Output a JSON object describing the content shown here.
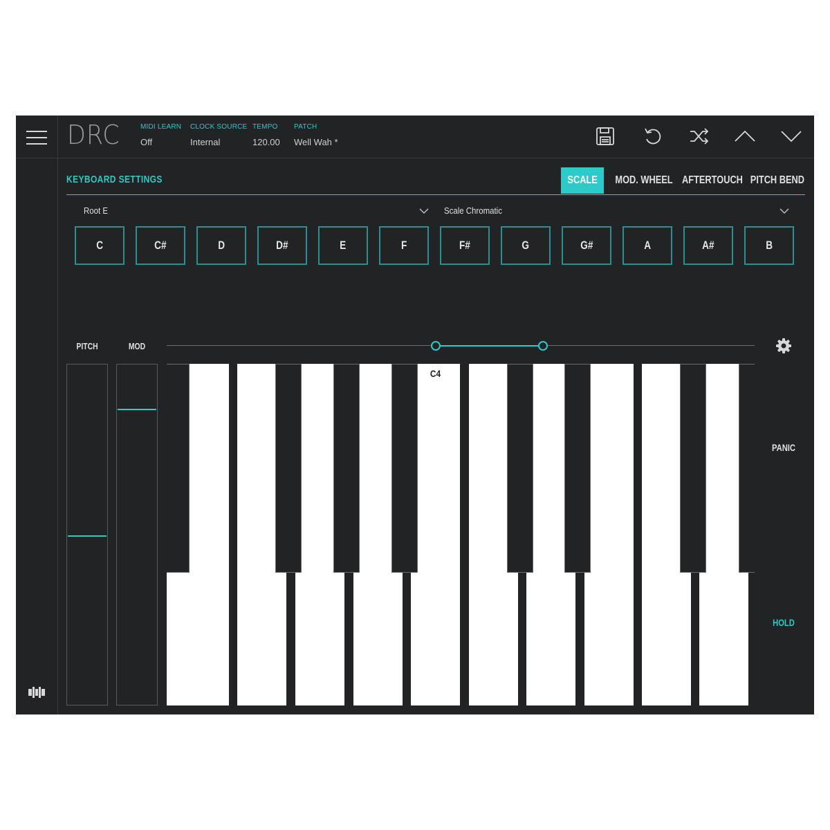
{
  "app": {
    "logo": "DRC",
    "accent_color": "#2ec9c9",
    "background_color": "#222324"
  },
  "header": {
    "info": [
      {
        "label": "MIDI LEARN",
        "value": "Off"
      },
      {
        "label": "CLOCK SOURCE",
        "value": "Internal"
      },
      {
        "label": "TEMPO",
        "value": "120.00"
      },
      {
        "label": "PATCH",
        "value": "Well Wah *"
      }
    ],
    "icons": [
      "save-icon",
      "undo-icon",
      "shuffle-icon",
      "chevron-up-icon",
      "chevron-down-icon"
    ]
  },
  "keyboard_settings": {
    "title": "KEYBOARD SETTINGS",
    "tabs": [
      {
        "label": "SCALE",
        "active": true
      },
      {
        "label": "MOD. WHEEL",
        "active": false
      },
      {
        "label": "AFTERTOUCH",
        "active": false
      },
      {
        "label": "PITCH BEND",
        "active": false
      }
    ],
    "root_dropdown": "Root E",
    "scale_dropdown": "Scale Chromatic",
    "notes": [
      "C",
      "C#",
      "D",
      "D#",
      "E",
      "F",
      "F#",
      "G",
      "G#",
      "A",
      "A#",
      "B"
    ]
  },
  "performance": {
    "pitch_label": "PITCH",
    "mod_label": "MOD",
    "pitch_level": 0.5,
    "mod_level": 0.87,
    "key_label": "C4",
    "panic_label": "PANIC",
    "hold_label": "HOLD"
  }
}
